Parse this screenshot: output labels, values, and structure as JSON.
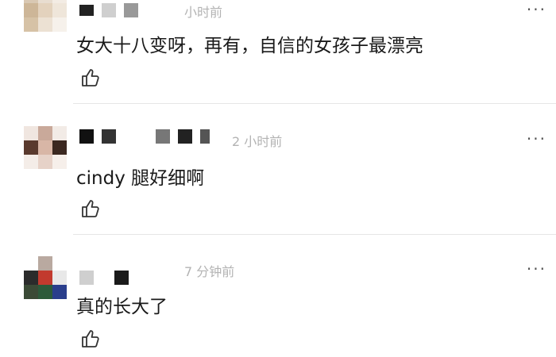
{
  "comments": [
    {
      "time": "小时前",
      "text": "女大十八变呀，再有，自信的女孩子最漂亮",
      "more_label": "···",
      "like_icon": "thumbs-up-icon"
    },
    {
      "time": "2 小时前",
      "text": "cindy 腿好细啊",
      "more_label": "···",
      "like_icon": "thumbs-up-icon"
    },
    {
      "time": "7 分钟前",
      "text": "真的长大了",
      "more_label": "···",
      "like_icon": "thumbs-up-icon"
    }
  ]
}
